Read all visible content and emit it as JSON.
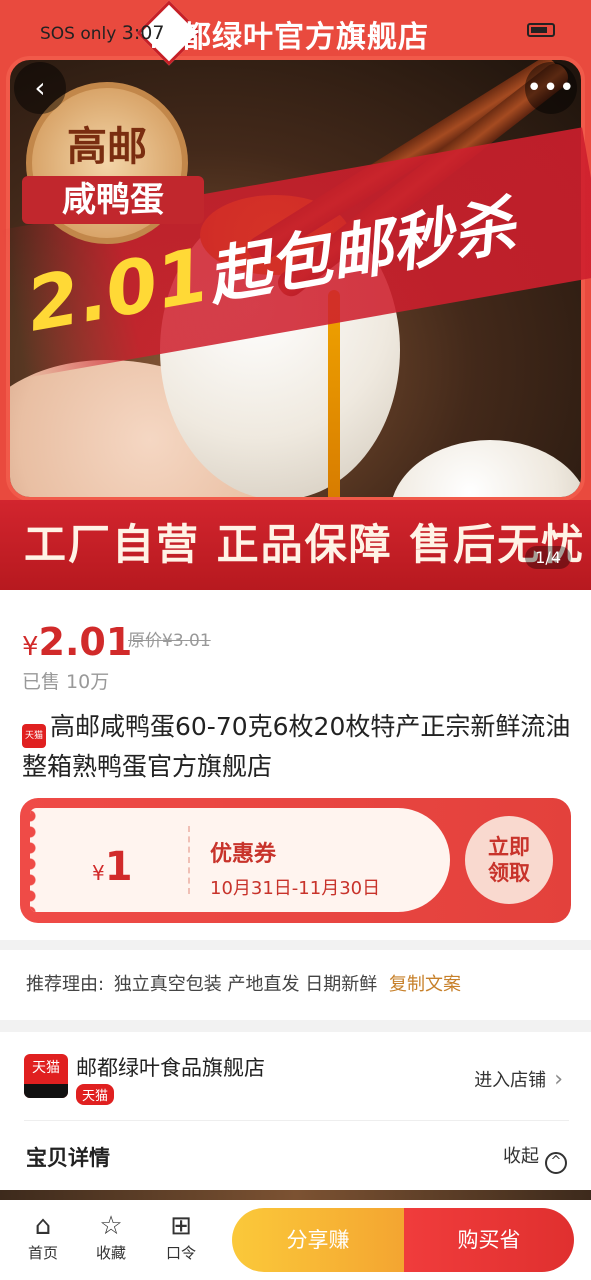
{
  "status_bar": {
    "carrier": "SOS only",
    "time": "3:07"
  },
  "store_header": {
    "title": "邮都绿叶官方旗舰店"
  },
  "hero": {
    "seal_top": "高邮",
    "seal_bottom": "咸鸭蛋",
    "promo_price": "2.01",
    "promo_text": "起包邮秒杀",
    "bottom_banner": "工厂自营 正品保障 售后无忧",
    "page_indicator": "1/4"
  },
  "product": {
    "currency": "¥",
    "price": "2.01",
    "original_price": "原价¥3.01",
    "sold": "已售 10万",
    "badge": "天猫",
    "title": "高邮咸鸭蛋60-70克6枚20枚特产正宗新鲜流油整箱熟鸭蛋官方旗舰店"
  },
  "coupon": {
    "currency": "¥",
    "amount": "1",
    "name": "优惠券",
    "date_range": "10月31日-11月30日",
    "claim_label_1": "立即",
    "claim_label_2": "领取"
  },
  "recommend": {
    "label": "推荐理由:",
    "text": "独立真空包装 产地直发 日期新鲜",
    "copy_label": "复制文案"
  },
  "store": {
    "avatar_text": "天猫",
    "name": "邮都绿叶食品旗舰店",
    "tag": "天猫",
    "enter_label": "进入店铺"
  },
  "details": {
    "title": "宝贝详情",
    "collapse_label": "收起"
  },
  "bottom_bar": {
    "tabs": [
      {
        "label": "首页",
        "icon": "home-icon"
      },
      {
        "label": "收藏",
        "icon": "star-icon"
      },
      {
        "label": "口令",
        "icon": "code-icon"
      }
    ],
    "share_label": "分享赚",
    "buy_label": "购买省"
  },
  "colors": {
    "accent_red": "#e02020",
    "price_red": "#d12a2a",
    "share_yellow": "#f4a531",
    "copy_gold": "#c7802a"
  }
}
